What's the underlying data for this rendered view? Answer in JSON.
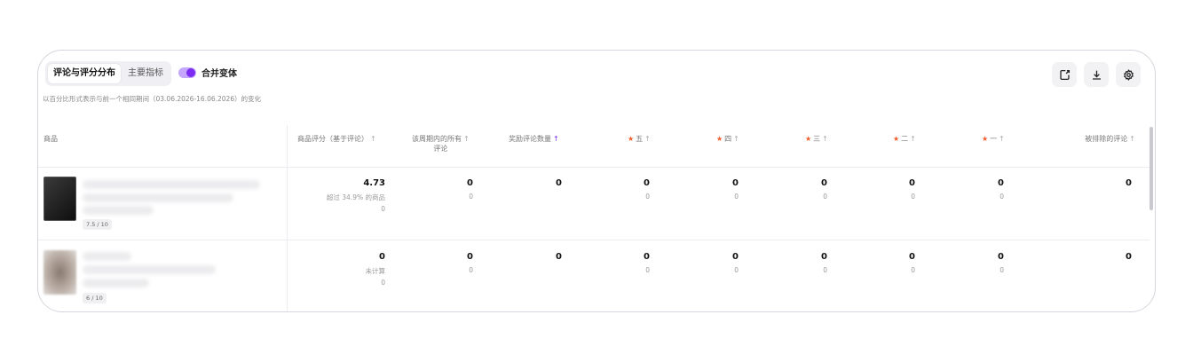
{
  "tabs": [
    {
      "label": "评论与评分分布",
      "active": true
    },
    {
      "label": "主要指标",
      "active": false
    }
  ],
  "toggle": {
    "label": "合并变体",
    "on": true,
    "color": "#7b2cf0"
  },
  "subtitle": "以百分比形式表示与前一个相同期间（03.06.2026-16.06.2026）的变化",
  "icons": [
    "export-icon",
    "download-icon",
    "settings-icon"
  ],
  "columns": {
    "product": "商品",
    "rating": "商品评分（基于评论）",
    "all_reviews": "该周期内的所有",
    "all_reviews_2": "评论",
    "rewarded": "奖励评论数量",
    "five": "五",
    "four": "四",
    "three": "三",
    "two": "二",
    "one": "一",
    "excluded": "被排除的评论",
    "arrow": "↑"
  },
  "rows": [
    {
      "score_badge": "7.5 / 10",
      "rating": "4.73",
      "rating_sub": "超过 34.9% 的商品",
      "rating_sub2": "0",
      "all": "0",
      "all_sub": "0",
      "rewarded": "0",
      "five": "0",
      "five_sub": "0",
      "four": "0",
      "four_sub": "0",
      "three": "0",
      "three_sub": "0",
      "two": "0",
      "two_sub": "0",
      "one": "0",
      "one_sub": "0",
      "excluded": "0"
    },
    {
      "score_badge": "6 / 10",
      "rating": "0",
      "rating_sub": "未计算",
      "rating_sub2": "0",
      "all": "0",
      "all_sub": "0",
      "rewarded": "0",
      "five": "0",
      "five_sub": "0",
      "four": "0",
      "four_sub": "0",
      "three": "0",
      "three_sub": "0",
      "two": "0",
      "two_sub": "0",
      "one": "0",
      "one_sub": "0",
      "excluded": "0"
    }
  ],
  "colors": {
    "accent": "#7b2cf0",
    "star": "#f05a28"
  }
}
